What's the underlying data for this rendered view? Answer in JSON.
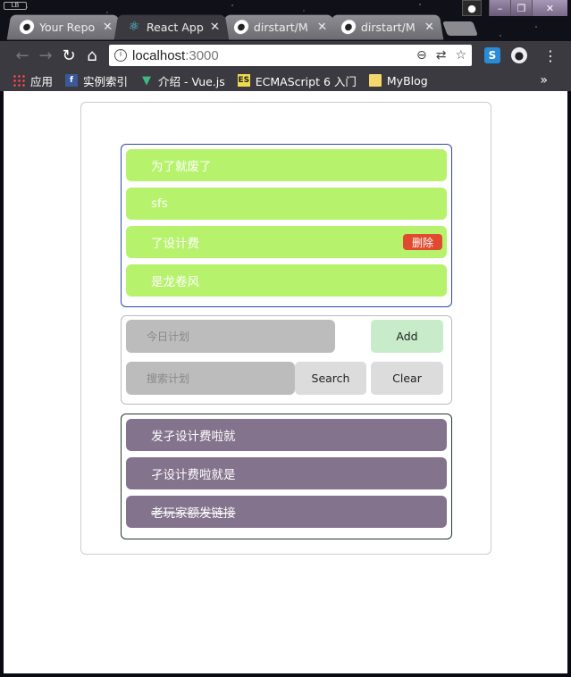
{
  "window": {
    "controls": [
      "user",
      "minimize",
      "maximize",
      "close"
    ]
  },
  "tabs": [
    {
      "title": "Your Repo",
      "icon": "github-icon",
      "active": false
    },
    {
      "title": "React App",
      "icon": "react-icon",
      "active": true
    },
    {
      "title": "dirstart/M",
      "icon": "github-icon",
      "active": false
    },
    {
      "title": "dirstart/M",
      "icon": "github-icon",
      "active": false
    }
  ],
  "toolbar": {
    "url_host": "localhost",
    "url_port": ":3000"
  },
  "bookmarks": [
    {
      "label": "应用",
      "icon": "apps-icon"
    },
    {
      "label": "实例索引",
      "icon": "facebook-icon"
    },
    {
      "label": "介绍 - Vue.js",
      "icon": "vue-icon"
    },
    {
      "label": "ECMAScript 6 入门",
      "icon": "es-icon"
    },
    {
      "label": "MyBlog",
      "icon": "folder-icon"
    }
  ],
  "todo": {
    "items": [
      {
        "text": "为了就废了"
      },
      {
        "text": "sfs"
      },
      {
        "text": "了设计费",
        "delete_label": "删除"
      },
      {
        "text": "是龙卷风"
      }
    ]
  },
  "form": {
    "plan_placeholder": "今日计划",
    "add_label": "Add",
    "search_placeholder": "搜索计划",
    "search_label": "Search",
    "clear_label": "Clear"
  },
  "done": {
    "items": [
      {
        "text": "发孑设计费啦就"
      },
      {
        "text": "孑设计费啦就是"
      },
      {
        "text": "老玩家额发链接"
      }
    ]
  },
  "colors": {
    "todo_item": "#b7f26d",
    "done_item": "#84738c",
    "delete_button": "#e04a2f",
    "add_button": "#c8ecca",
    "todo_border": "#2b4aa8"
  }
}
